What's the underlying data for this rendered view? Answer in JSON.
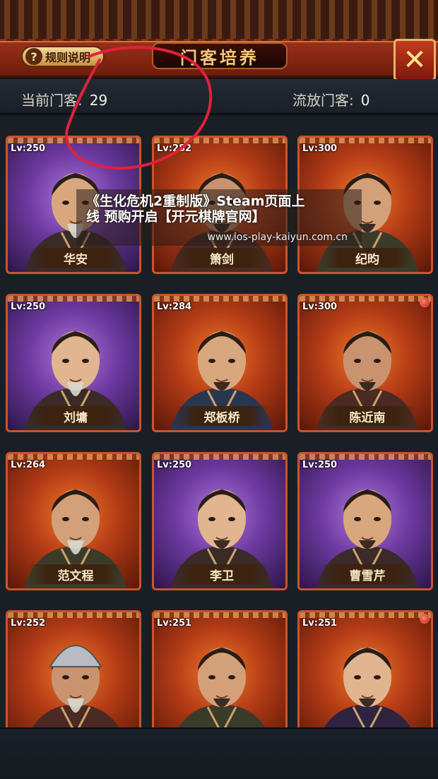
{
  "header": {
    "title": "门客培养",
    "rules_label": "规则说明",
    "rules_icon": "question-icon",
    "close_icon": "close-x-icon"
  },
  "stats": {
    "current_label": "当前门客:",
    "current_value": "29",
    "exiled_label": "流放门客:",
    "exiled_value": "0"
  },
  "retainers": [
    {
      "level": "Lv:250",
      "name": "华安",
      "frame": "purple",
      "badge": false
    },
    {
      "level": "Lv:282",
      "name": "箫剑",
      "frame": "orange",
      "badge": false
    },
    {
      "level": "Lv:300",
      "name": "纪昀",
      "frame": "orange",
      "badge": false
    },
    {
      "level": "Lv:250",
      "name": "刘墉",
      "frame": "purple",
      "badge": false
    },
    {
      "level": "Lv:284",
      "name": "郑板桥",
      "frame": "orange",
      "badge": false
    },
    {
      "level": "Lv:300",
      "name": "陈近南",
      "frame": "orange",
      "badge": true
    },
    {
      "level": "Lv:264",
      "name": "范文程",
      "frame": "orange",
      "badge": false
    },
    {
      "level": "Lv:250",
      "name": "李卫",
      "frame": "purple",
      "badge": false
    },
    {
      "level": "Lv:250",
      "name": "曹雪芹",
      "frame": "purple",
      "badge": false
    },
    {
      "level": "Lv:252",
      "name": "",
      "frame": "orange",
      "badge": false
    },
    {
      "level": "Lv:251",
      "name": "",
      "frame": "orange",
      "badge": false
    },
    {
      "level": "Lv:251",
      "name": "",
      "frame": "orange",
      "badge": true
    }
  ],
  "watermark": {
    "line1": "《生化危机2重制版》Steam页面上",
    "line2": "线 预购开启【开元棋牌官网】",
    "url": "www.ios-play-kaiyun.com.cn"
  },
  "colors": {
    "accent_red": "#9a2f18",
    "gold": "#f3c778",
    "frame_orange": "#c9542b",
    "frame_purple": "#6e3aa2",
    "annotation": "#e0213a"
  }
}
